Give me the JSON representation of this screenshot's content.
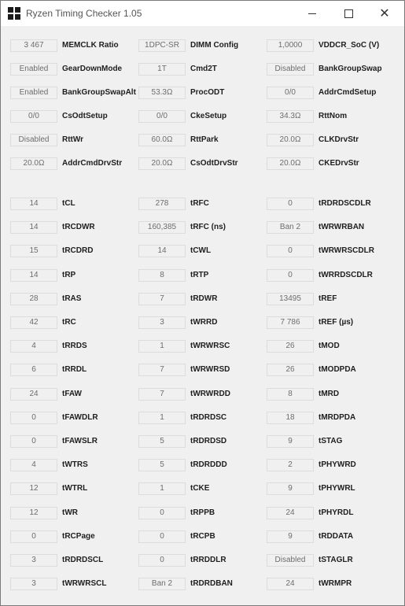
{
  "window": {
    "title": "Ryzen Timing Checker 1.05",
    "controls": {
      "minimize": "—",
      "maximize": "☐",
      "close": "✕"
    }
  },
  "config": {
    "col1": [
      {
        "value": "3 467",
        "label": "MEMCLK Ratio"
      },
      {
        "value": "Enabled",
        "label": "GearDownMode"
      },
      {
        "value": "Enabled",
        "label": "BankGroupSwapAlt"
      },
      {
        "value": "0/0",
        "label": "CsOdtSetup"
      },
      {
        "value": "Disabled",
        "label": "RttWr"
      },
      {
        "value": "20.0Ω",
        "label": "AddrCmdDrvStr"
      }
    ],
    "col2": [
      {
        "value": "1DPC-SR",
        "label": "DIMM Config"
      },
      {
        "value": "1T",
        "label": "Cmd2T"
      },
      {
        "value": "53.3Ω",
        "label": "ProcODT"
      },
      {
        "value": "0/0",
        "label": "CkeSetup"
      },
      {
        "value": "60.0Ω",
        "label": "RttPark"
      },
      {
        "value": "20.0Ω",
        "label": "CsOdtDrvStr"
      }
    ],
    "col3": [
      {
        "value": "1,0000",
        "label": "VDDCR_SoC (V)"
      },
      {
        "value": "Disabled",
        "label": "BankGroupSwap"
      },
      {
        "value": "0/0",
        "label": "AddrCmdSetup"
      },
      {
        "value": "34.3Ω",
        "label": "RttNom"
      },
      {
        "value": "20.0Ω",
        "label": "CLKDrvStr"
      },
      {
        "value": "20.0Ω",
        "label": "CKEDrvStr"
      }
    ]
  },
  "timings": {
    "col1": [
      {
        "value": "14",
        "label": "tCL"
      },
      {
        "value": "14",
        "label": "tRCDWR"
      },
      {
        "value": "15",
        "label": "tRCDRD"
      },
      {
        "value": "14",
        "label": "tRP"
      },
      {
        "value": "28",
        "label": "tRAS"
      },
      {
        "value": "42",
        "label": "tRC"
      },
      {
        "value": "4",
        "label": "tRRDS"
      },
      {
        "value": "6",
        "label": "tRRDL"
      },
      {
        "value": "24",
        "label": "tFAW"
      },
      {
        "value": "0",
        "label": "tFAWDLR"
      },
      {
        "value": "0",
        "label": "tFAWSLR"
      },
      {
        "value": "4",
        "label": "tWTRS"
      },
      {
        "value": "12",
        "label": "tWTRL"
      },
      {
        "value": "12",
        "label": "tWR"
      },
      {
        "value": "0",
        "label": "tRCPage"
      },
      {
        "value": "3",
        "label": "tRDRDSCL"
      },
      {
        "value": "3",
        "label": "tWRWRSCL"
      }
    ],
    "col2": [
      {
        "value": "278",
        "label": "tRFC"
      },
      {
        "value": "160,385",
        "label": "tRFC (ns)"
      },
      {
        "value": "14",
        "label": "tCWL"
      },
      {
        "value": "8",
        "label": "tRTP"
      },
      {
        "value": "7",
        "label": "tRDWR"
      },
      {
        "value": "3",
        "label": "tWRRD"
      },
      {
        "value": "1",
        "label": "tWRWRSC"
      },
      {
        "value": "7",
        "label": "tWRWRSD"
      },
      {
        "value": "7",
        "label": "tWRWRDD"
      },
      {
        "value": "1",
        "label": "tRDRDSC"
      },
      {
        "value": "5",
        "label": "tRDRDSD"
      },
      {
        "value": "5",
        "label": "tRDRDDD"
      },
      {
        "value": "1",
        "label": "tCKE"
      },
      {
        "value": "0",
        "label": "tRPPB"
      },
      {
        "value": "0",
        "label": "tRCPB"
      },
      {
        "value": "0",
        "label": "tRRDDLR"
      },
      {
        "value": "Ban 2",
        "label": "tRDRDBAN"
      }
    ],
    "col3": [
      {
        "value": "0",
        "label": "tRDRDSCDLR"
      },
      {
        "value": "Ban 2",
        "label": "tWRWRBAN"
      },
      {
        "value": "0",
        "label": "tWRWRSCDLR"
      },
      {
        "value": "0",
        "label": "tWRRDSCDLR"
      },
      {
        "value": "13495",
        "label": "tREF"
      },
      {
        "value": "7 786",
        "label": "tREF (µs)"
      },
      {
        "value": "26",
        "label": "tMOD"
      },
      {
        "value": "26",
        "label": "tMODPDA"
      },
      {
        "value": "8",
        "label": "tMRD"
      },
      {
        "value": "18",
        "label": "tMRDPDA"
      },
      {
        "value": "9",
        "label": "tSTAG"
      },
      {
        "value": "2",
        "label": "tPHYWRD"
      },
      {
        "value": "9",
        "label": "tPHYWRL"
      },
      {
        "value": "24",
        "label": "tPHYRDL"
      },
      {
        "value": "9",
        "label": "tRDDATA"
      },
      {
        "value": "Disabled",
        "label": "tSTAGLR"
      },
      {
        "value": "24",
        "label": "tWRMPR"
      }
    ]
  }
}
